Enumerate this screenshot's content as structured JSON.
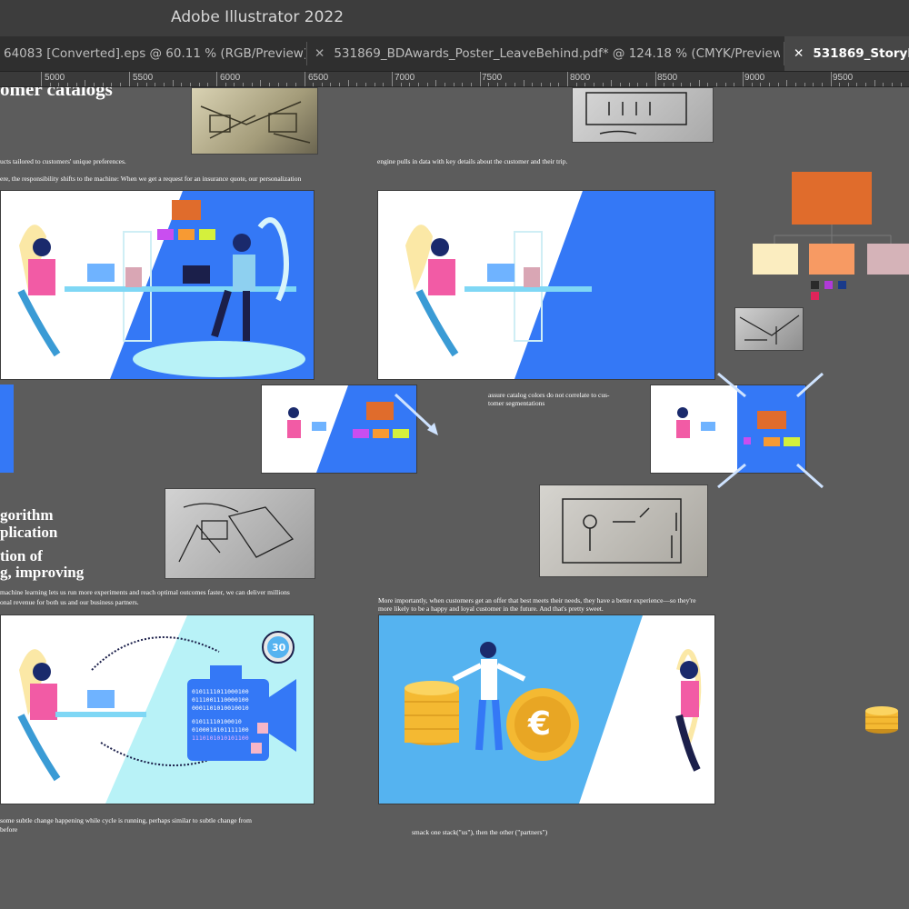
{
  "app": {
    "title": "Adobe Illustrator 2022"
  },
  "tabs": [
    {
      "label": "64083 [Converted].eps @ 60.11 % (RGB/Preview)",
      "active": false,
      "close": ""
    },
    {
      "label": "531869_BDAwards_Poster_LeaveBehind.pdf* @ 124.18 % (CMYK/Preview)",
      "active": false,
      "close": "✕"
    },
    {
      "label": "531869_Storybo",
      "active": true,
      "close": "✕"
    }
  ],
  "ruler": [
    "5000",
    "5500",
    "6000",
    "6500",
    "7000",
    "7500",
    "8000",
    "8500",
    "9000",
    "9500"
  ],
  "artboard": {
    "heading_top": "omer catalogs",
    "note_1a": "ucts tailored to customers' unique preferences.",
    "note_1b": "ere, the responsibility shifts to the machine: When we get a request for an insurance quote, our personalization",
    "note_2": "engine pulls in data with key details about the customer and their trip.",
    "note_3a": "assure catalog colors do not correlate to cus-",
    "note_3b": "tomer segmentations",
    "heading_mid_1": "gorithm",
    "heading_mid_2": "plication",
    "heading_mid_3": "tion of",
    "heading_mid_4": "g, improving",
    "note_4a": "machine learning lets us run more experiments and reach optimal outcomes faster, we can deliver millions",
    "note_4b": "onal revenue for both us and our business partners.",
    "note_5a": "More importantly, when customers get an offer that best meets their needs, they have a better experience—so they're",
    "note_5b": "more likely to be a happy and loyal customer in the future. And that's pretty sweet.",
    "note_6a": "some subtle change happening while cycle is running, perhaps similar to subtle change from",
    "note_6b": "before",
    "note_7": "smack one stack(\"us\"), then the other (\"partners\")",
    "timer_label": "30",
    "coin_symbol": "€",
    "binary_lines": [
      "0101111011000100",
      "0111001110000100",
      "0001101010010010",
      "01011110100010",
      "0100010101111100",
      "1110101010101100"
    ],
    "binary_arc": "1001010110010110111101100010001110001100 0110001100101001001110010110 1110011001100"
  },
  "colors": {
    "accent_blue": "#3478f6",
    "accent_orange": "#e06c2c",
    "light_cyan": "#b8f2f7",
    "sky_blue": "#55b3f0",
    "coin_gold": "#f4b932"
  }
}
